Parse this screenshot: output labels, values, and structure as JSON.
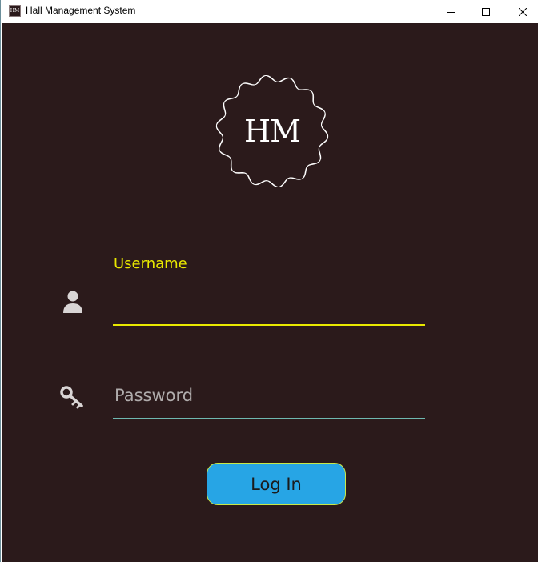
{
  "window": {
    "title": "Hall Management System",
    "icon_text": "HM",
    "controls": {
      "minimize": "minimize-icon",
      "maximize": "maximize-icon",
      "close": "close-icon"
    }
  },
  "logo": {
    "text": "HM"
  },
  "form": {
    "username": {
      "label": "Username",
      "value": "",
      "icon": "user-icon"
    },
    "password": {
      "placeholder": "Password",
      "value": "",
      "icon": "key-icon"
    },
    "login_label": "Log In"
  },
  "colors": {
    "background": "#2b1a1b",
    "accent": "#e8e800",
    "button": "#27a5e5",
    "password_underline": "#6fb8b0"
  }
}
